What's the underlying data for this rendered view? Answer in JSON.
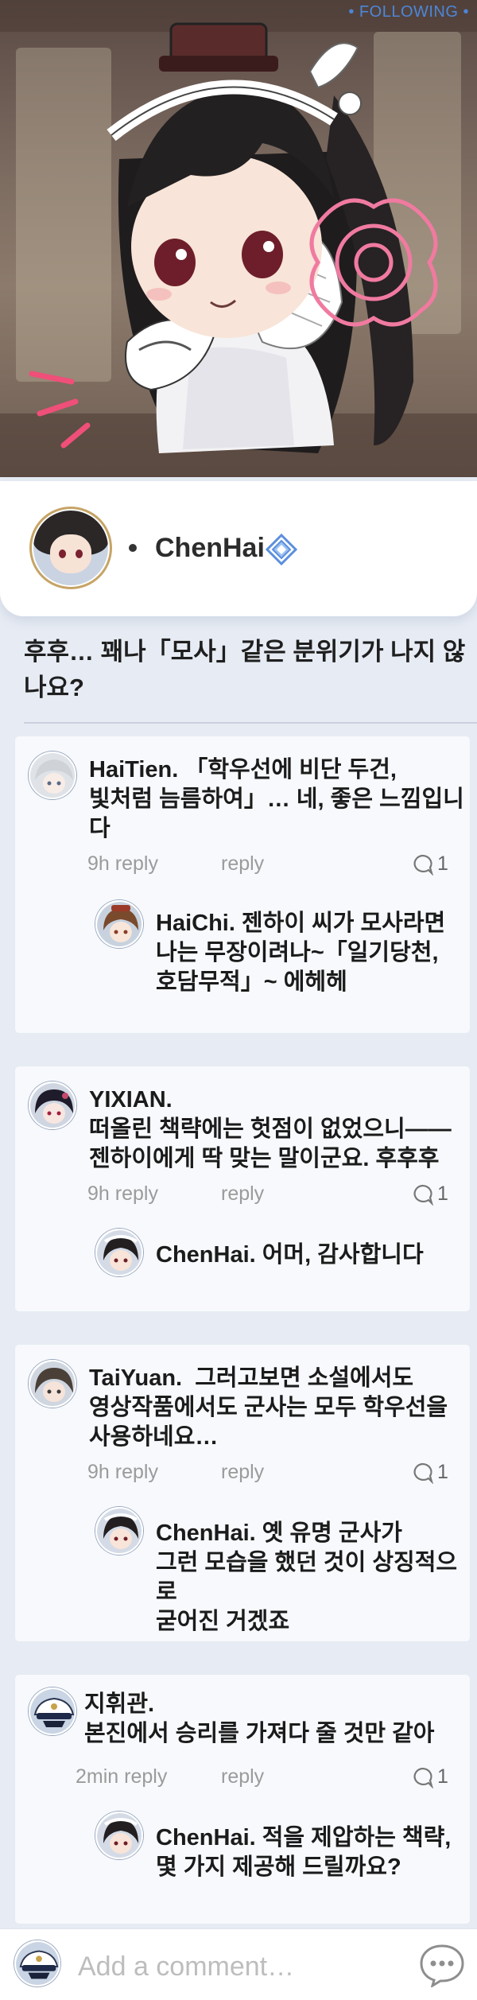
{
  "post": {
    "following_label": "• FOLLOWING •",
    "author": "ChenHai",
    "text": "후후… 꽤나「모사」같은 분위기가 나지 않나요?"
  },
  "comments": [
    {
      "author": "HaiTien.",
      "line1": "「학우선에 비단 두건,",
      "line2": "빛처럼 늠름하여」… 네, 좋은 느낌입니다",
      "time": "9h reply",
      "reply_label": "reply",
      "count": "1",
      "reply": {
        "author": "HaiChi.",
        "line1": "젠하이 씨가 모사라면",
        "line2": "나는 무장이려나~「일기당천,",
        "line3": "호담무적」~ 에헤헤"
      }
    },
    {
      "author": "YIXIAN.",
      "line1": "떠올린 책략에는 헛점이 없었으니——",
      "line2": "젠하이에게 딱 맞는 말이군요. 후후후",
      "time": "9h reply",
      "reply_label": "reply",
      "count": "1",
      "reply": {
        "author": "ChenHai.",
        "line1": "어머, 감사합니다"
      }
    },
    {
      "author": "TaiYuan.",
      "line1": "그러고보면 소설에서도",
      "line2": "영상작품에서도 군사는 모두 학우선을",
      "line3": "사용하네요…",
      "time": "9h reply",
      "reply_label": "reply",
      "count": "1",
      "reply": {
        "author": "ChenHai.",
        "line1": "옛 유명 군사가",
        "line2": "그런 모습을 했던 것이 상징적으로",
        "line3": "굳어진 거겠죠"
      }
    },
    {
      "author": "지휘관.",
      "line1": "본진에서 승리를 가져다 줄 것만 같아",
      "time": "2min reply",
      "reply_label": "reply",
      "count": "1",
      "reply": {
        "author": "ChenHai.",
        "line1": "적을 제압하는 책략,",
        "line2": "몇 가지 제공해 드릴까요?"
      }
    }
  ],
  "composer": {
    "placeholder": "Add a comment…"
  },
  "icons": {
    "verified": "verified-diamond-icon",
    "comment": "speech-bubble-icon",
    "chat": "chat-dots-icon"
  },
  "colors": {
    "accent": "#4d86d8",
    "background": "#e7ecf4"
  }
}
